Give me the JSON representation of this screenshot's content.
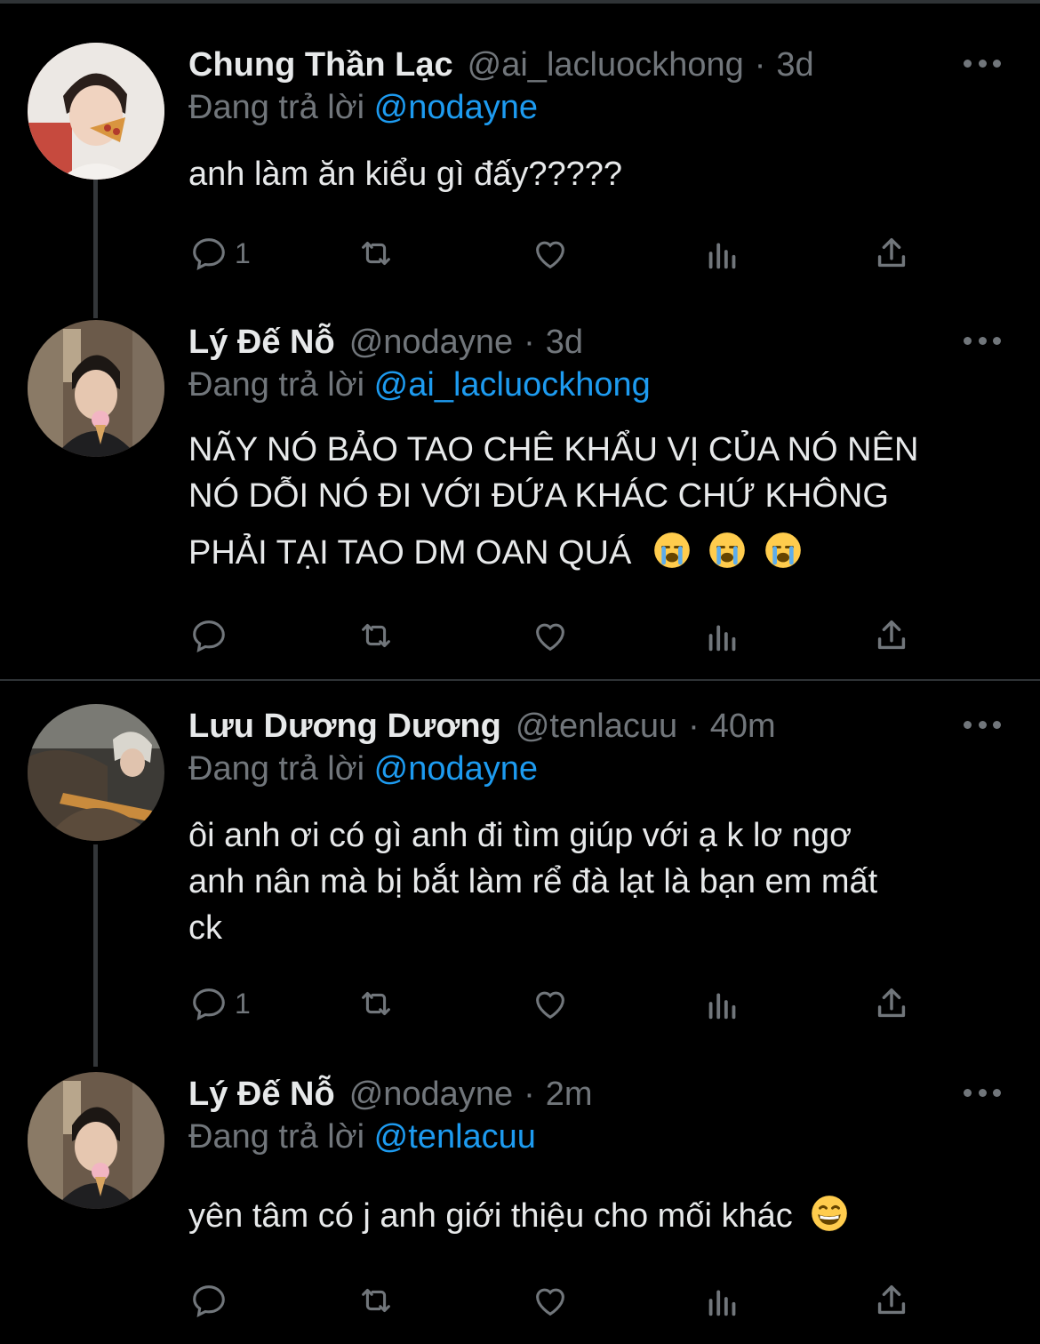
{
  "tweets": [
    {
      "name": "Chung Thần Lạc",
      "handle": "@ai_lacluockhong",
      "dot": "·",
      "time": "3d",
      "reply_prefix": "Đang trả lời",
      "reply_to": "@nodayne",
      "text_lines": [
        "anh làm ăn kiểu gì đấy?????"
      ],
      "reply_count": "1",
      "emoji": ""
    },
    {
      "name": "Lý Đế Nỗ",
      "handle": "@nodayne",
      "dot": "·",
      "time": "3d",
      "reply_prefix": "Đang trả lời",
      "reply_to": "@ai_lacluockhong",
      "text_lines": [
        "NÃY NÓ BẢO TAO CHÊ KHẨU VỊ CỦA NÓ NÊN",
        "NÓ DỖI NÓ ĐI VỚI ĐỨA KHÁC CHỨ KHÔNG",
        "PHẢI TẠI TAO DM OAN QUÁ"
      ],
      "reply_count": "",
      "emoji": "crying-face x3"
    },
    {
      "name": "Lưu Dương Dương",
      "handle": "@tenlacuu",
      "dot": "·",
      "time": "40m",
      "reply_prefix": "Đang trả lời",
      "reply_to": "@nodayne",
      "text_lines": [
        "ôi anh ơi có gì anh đi tìm giúp với ạ k lơ ngơ",
        "anh nân mà bị bắt làm rể đà lạt là bạn em mất",
        "ck"
      ],
      "reply_count": "1",
      "emoji": ""
    },
    {
      "name": "Lý Đế Nỗ",
      "handle": "@nodayne",
      "dot": "·",
      "time": "2m",
      "reply_prefix": "Đang trả lời",
      "reply_to": "@tenlacuu",
      "text_lines": [
        "yên tâm có j anh giới thiệu cho mối khác"
      ],
      "reply_count": "",
      "emoji": "grinning-face"
    }
  ],
  "colors": {
    "background": "#000000",
    "text": "#e7e9ea",
    "muted": "#71767b",
    "link": "#1d9bf0",
    "divider": "#2f3336"
  },
  "icons": [
    "reply-icon",
    "retweet-icon",
    "like-icon",
    "analytics-icon",
    "share-icon",
    "more-icon"
  ]
}
